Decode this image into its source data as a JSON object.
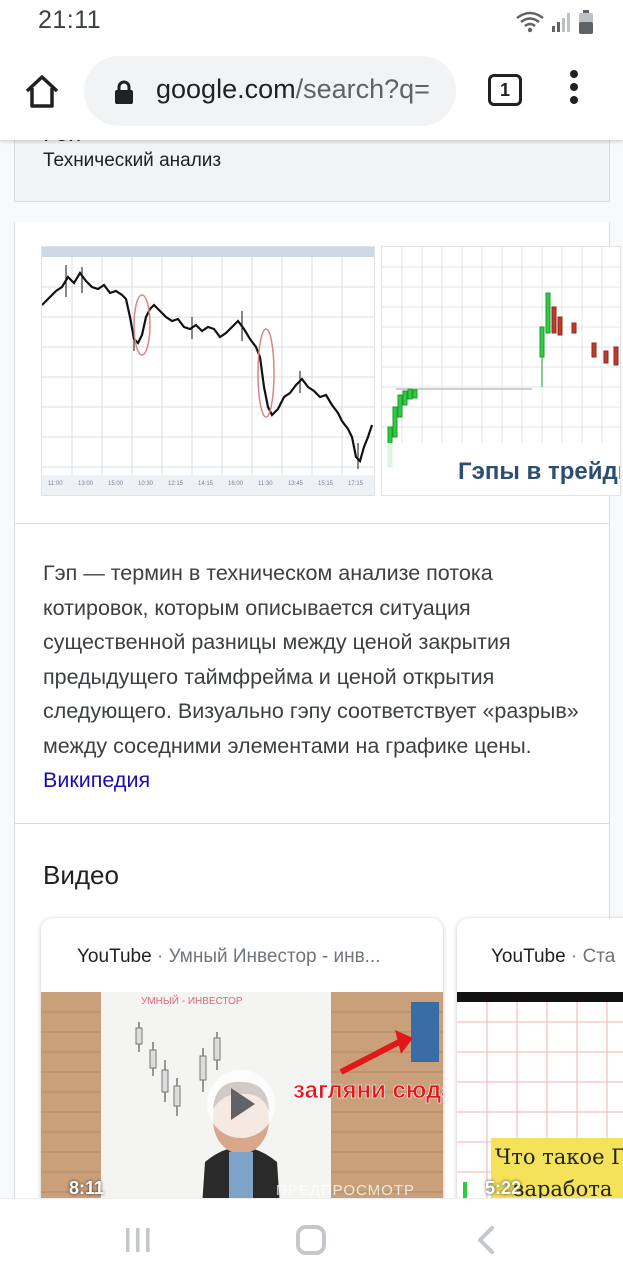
{
  "status_bar": {
    "time": "21:11"
  },
  "browser": {
    "url_main": "google.com",
    "url_rest": "/search?q=",
    "tab_count": "1"
  },
  "knowledge_panel": {
    "title": "Гэп",
    "subtitle": "Технический анализ"
  },
  "images": {
    "thumb2_caption": "Гэпы в трейдин"
  },
  "description": {
    "text": "Гэп — термин в техническом анализе потока котировок, которым описывается ситуация существенной разницы между ценой закрытия предыдущего таймфрейма и ценой открытия следующего. Визуально гэпу соответствует «разрыв» между соседними элементами на графике цены. ",
    "source_link": "Википедия"
  },
  "videos": {
    "heading": "Видео",
    "items": [
      {
        "source": "YouTube",
        "separator": " · ",
        "channel": "Умный Инвестор - инв...",
        "duration": "8:11",
        "preview_label": "ПРЕДПРОСМОТР",
        "overlay_text": "загляни сюда",
        "board_text": "УМНЫЙ - ИНВЕСТОР"
      },
      {
        "source": "YouTube",
        "separator": " · ",
        "channel": "Ста",
        "duration": "5:22",
        "overlay_text_1": "Что такое ГЭ",
        "overlay_text_2": "заработа"
      }
    ]
  },
  "colors": {
    "link": "#1a0dab",
    "candle_up": "#2ecc40",
    "candle_down": "#c0392b",
    "overlay_red": "#e3161b"
  }
}
